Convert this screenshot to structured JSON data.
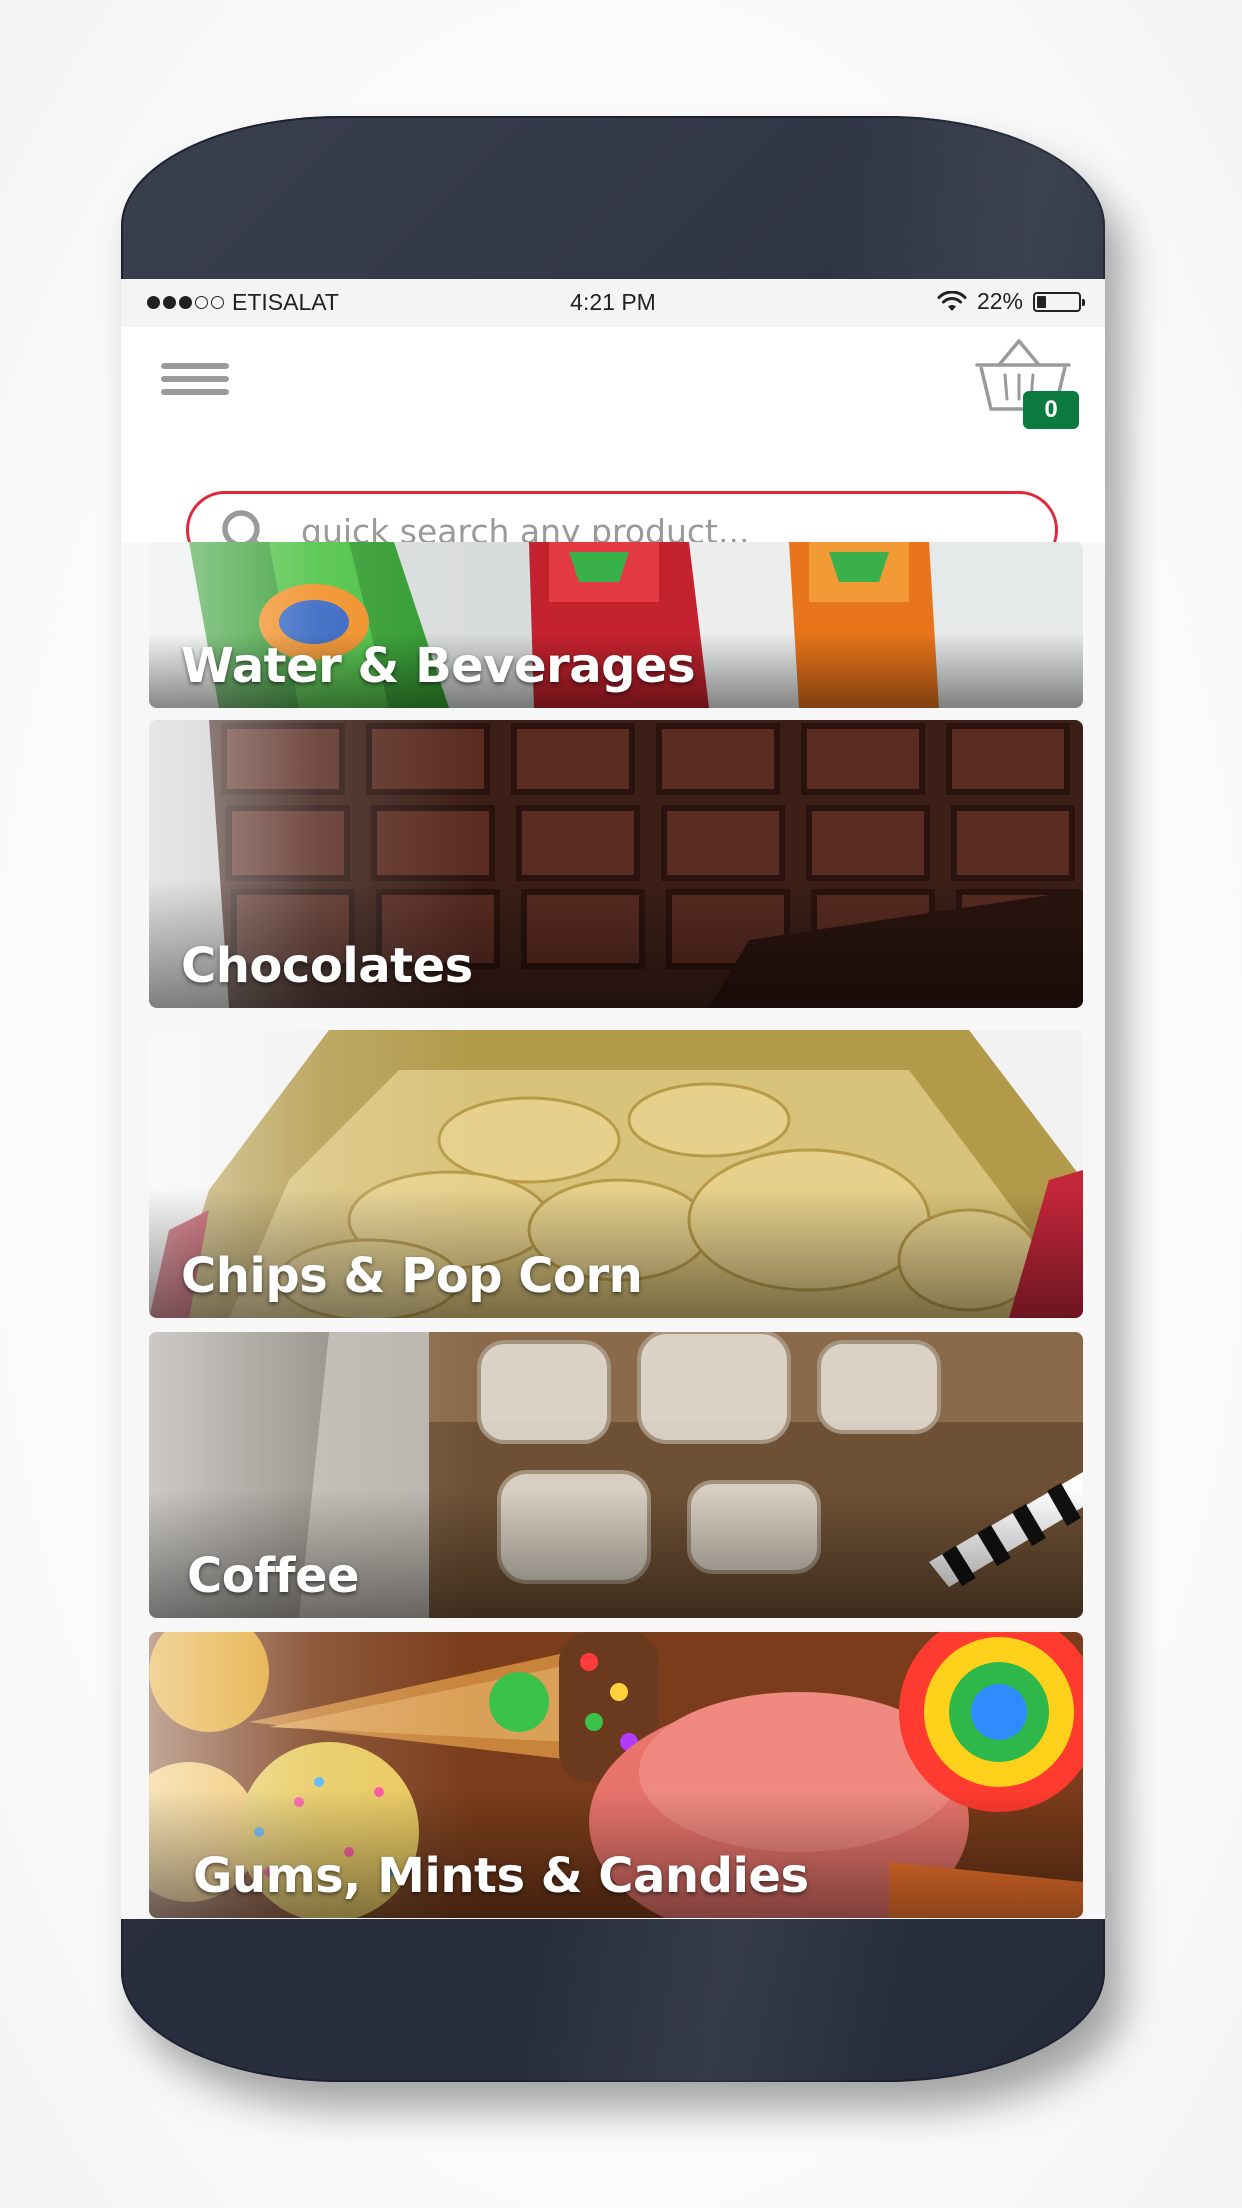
{
  "status_bar": {
    "carrier": "ETISALAT",
    "time": "4:21 PM",
    "battery_percent": "22%",
    "battery_level": 0.22,
    "signal_bars_filled": 3,
    "signal_bars_total": 5
  },
  "header": {
    "menu_icon": "hamburger-menu-icon",
    "cart_icon": "shopping-basket-icon",
    "cart_count": "0",
    "cart_badge_color": "#0b7a3e"
  },
  "search": {
    "placeholder": "quick search any product...",
    "value": "",
    "border_color": "#e0283a"
  },
  "categories": [
    {
      "label": "Water & Beverages",
      "image": "soda-bottles"
    },
    {
      "label": "Chocolates",
      "image": "chocolate-bar"
    },
    {
      "label": "Chips & Pop Corn",
      "image": "potato-chips-bag"
    },
    {
      "label": "Coffee",
      "image": "iced-coffee-glass"
    },
    {
      "label": "Gums, Mints & Candies",
      "image": "assorted-candies"
    }
  ]
}
